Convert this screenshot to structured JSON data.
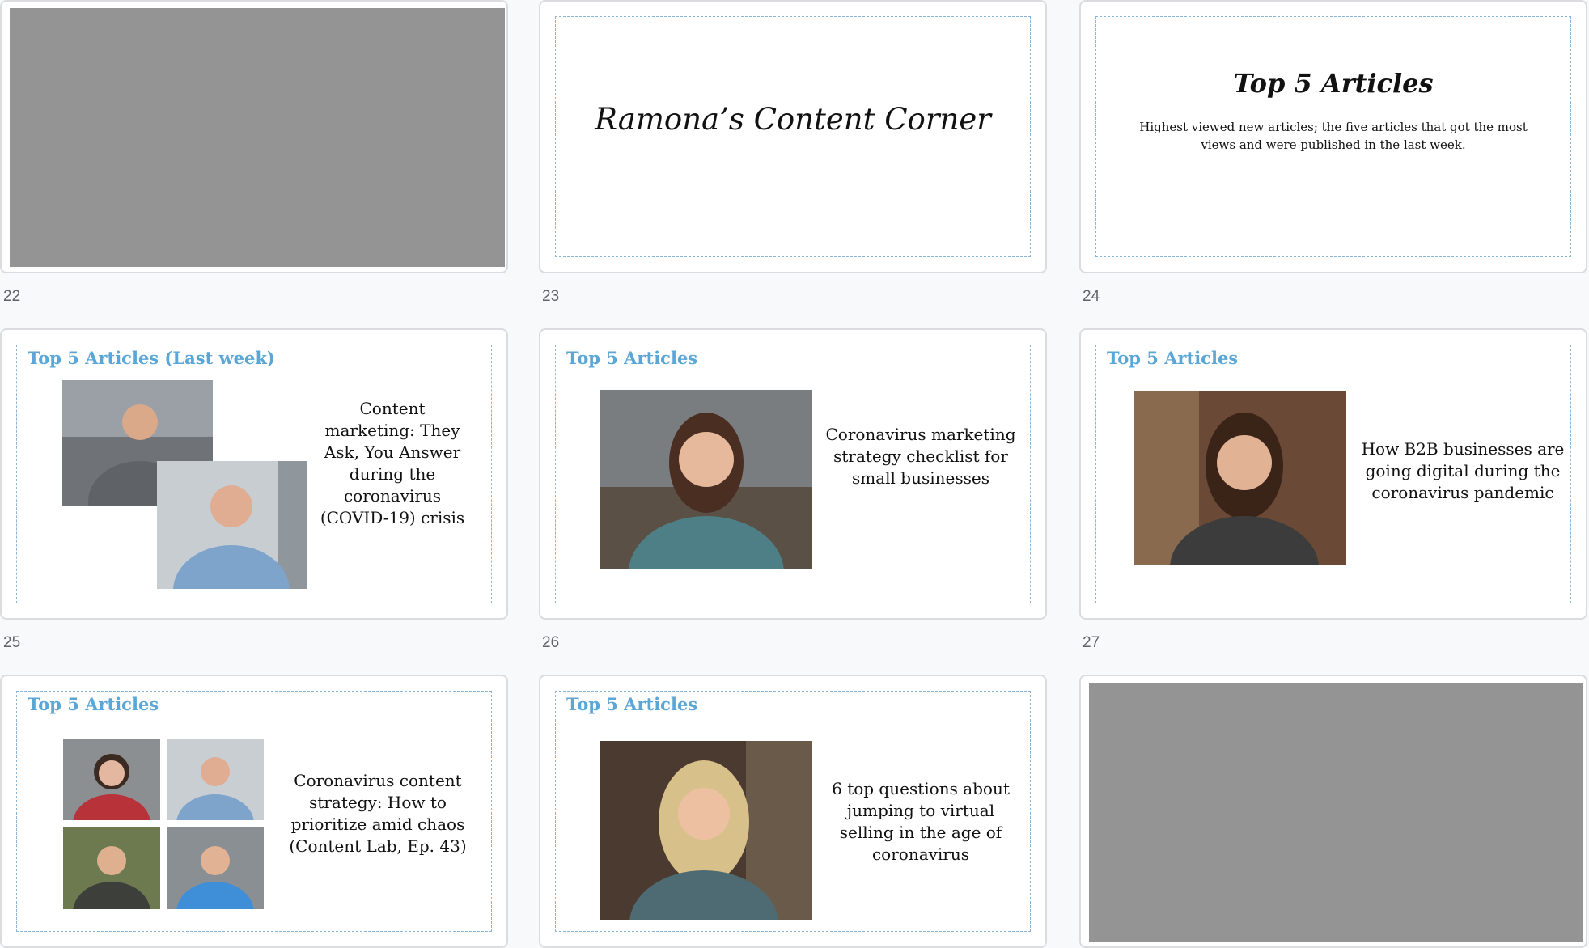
{
  "slides": [
    {
      "number": "22"
    },
    {
      "number": "23",
      "title": "Ramona’s Content Corner"
    },
    {
      "number": "24",
      "title": "Top 5 Articles",
      "subtitle": "Highest viewed new articles; the five articles that got the most views and were published in the last week."
    },
    {
      "number": "25",
      "title": "Top 5 Articles (Last week)",
      "article": "Content marketing: They Ask, You Answer during the coronavirus (COVID-19) crisis"
    },
    {
      "number": "26",
      "title": "Top 5 Articles",
      "article": "Coronavirus marketing strategy checklist for small businesses"
    },
    {
      "number": "27",
      "title": "Top 5 Articles",
      "article": "How B2B businesses are going digital during the coronavirus pandemic"
    },
    {
      "title": "Top 5 Articles",
      "article": "Coronavirus content strategy: How to prioritize amid chaos (Content Lab, Ep. 43)"
    },
    {
      "title": "Top 5 Articles",
      "article": "6 top questions about jumping to virtual selling in the age of coronavirus"
    },
    {}
  ],
  "colors": {
    "accent": "#5aa6d6",
    "placeholder_gray": "#949494",
    "frame_dash": "#8ab4d8"
  }
}
